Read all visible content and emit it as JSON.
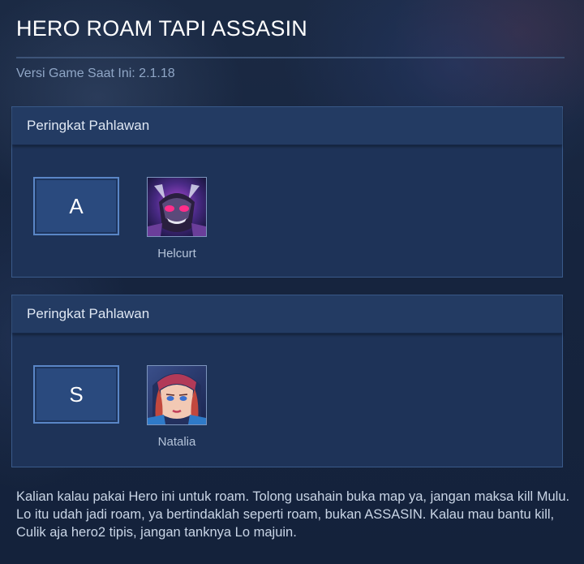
{
  "header": {
    "title": "HERO ROAM TAPI ASSASIN",
    "version_text": "Versi Game Saat Ini: 2.1.18"
  },
  "panels": [
    {
      "heading": "Peringkat Pahlawan",
      "tier": "A",
      "heroes": [
        {
          "name": "Helcurt",
          "portrait_icon": "helcurt-portrait"
        }
      ]
    },
    {
      "heading": "Peringkat Pahlawan",
      "tier": "S",
      "heroes": [
        {
          "name": "Natalia",
          "portrait_icon": "natalia-portrait"
        }
      ]
    }
  ],
  "description": "Kalian kalau pakai Hero ini untuk roam. Tolong usahain buka map ya, jangan maksa kill Mulu. Lo itu udah jadi roam, ya bertindaklah seperti roam, bukan ASSASIN. Kalau mau bantu kill, Culik aja hero2 tipis, jangan tanknya Lo majuin.",
  "colors": {
    "background": "#16243e",
    "panel": "#1e3358",
    "panel_header": "#233b63",
    "rank_border": "#5a86c6",
    "muted_text": "#8fa6c6"
  }
}
